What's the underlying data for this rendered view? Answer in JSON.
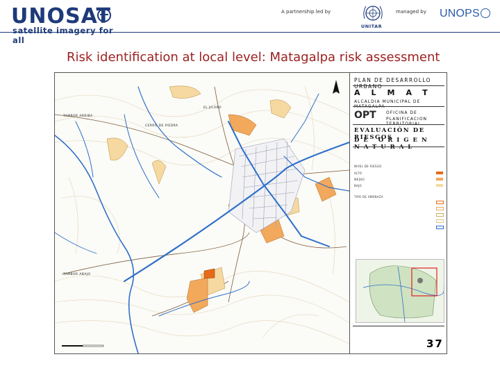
{
  "header": {
    "logo_text": "UNOSAT",
    "logo_tagline": "satellite imagery for all",
    "partnership_text": "A partnership led by",
    "unitar_label": "UNITAR",
    "managed_text": "managed by",
    "unops_text": "UNOPS"
  },
  "slide": {
    "title": "Risk identification at local level: Matagalpa risk assessment"
  },
  "map": {
    "place_labels": [
      "EL JICARO",
      "TAMBOR ARRIBA",
      "CERRO DE PIEDRA",
      "TAMBOR ABAJO"
    ],
    "legend": {
      "line1": "PLAN DE DESARROLLO URBANO",
      "line2": "ALMAT",
      "line3": "ALCALDIA MUNICIPAL DE MATAGALPA",
      "opt_logo": "OPT",
      "opt_line1": "OFICINA DE",
      "opt_line2": "PLANIFICACION TERRITORIAL",
      "eval_line1": "EVALUACIÓN DE RIESGOS",
      "eval_line2": "DE ORIGEN NATURAL",
      "section_riesgo": "NIVEL DE RIESGO",
      "riesgo_alto": "ALTO",
      "riesgo_medio": "MEDIO",
      "riesgo_bajo": "BAJO",
      "section_amenaza": "TIPO DE AMENAZA",
      "sheet_number": "37"
    },
    "colors": {
      "river": "#2f6fc9",
      "high_risk": "#e66a1a",
      "medium_risk": "#f2a95c",
      "low_risk": "#f5d9a0",
      "urban_grid": "#9aa0b5"
    }
  }
}
